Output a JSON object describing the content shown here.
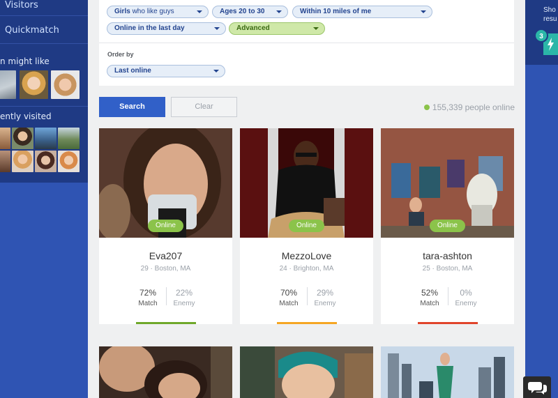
{
  "sidebar": {
    "visitors_label": "Visitors",
    "quickmatch_label": "Quickmatch",
    "might_like_heading": "n might like",
    "recently_visited_heading": "ently visited"
  },
  "filters": {
    "gender": {
      "bold": "Girls",
      "light": " who like guys"
    },
    "age": "Ages 20 to 30",
    "distance": "Within 10 miles of me",
    "activity": "Online in the last day",
    "advanced": "Advanced",
    "order_by_label": "Order by",
    "order_by_value": "Last online"
  },
  "actions": {
    "search_label": "Search",
    "clear_label": "Clear"
  },
  "online": {
    "text": "155,339 people online"
  },
  "colors": {
    "accent": "#3160c8",
    "online_green": "#8bc34a",
    "sidebar_dark": "#1f3a84",
    "sidebar_blue": "#2f54b3",
    "bar_green": "#6fa82a",
    "bar_orange": "#f5a623",
    "bar_red": "#e0442b"
  },
  "profiles": [
    {
      "name": "Eva207",
      "meta": "29 · Boston, MA",
      "badge": "Online",
      "match_pct": "72%",
      "match_label": "Match",
      "enemy_pct": "22%",
      "enemy_label": "Enemy"
    },
    {
      "name": "MezzoLove",
      "meta": "24 · Brighton, MA",
      "badge": "Online",
      "match_pct": "70%",
      "match_label": "Match",
      "enemy_pct": "29%",
      "enemy_label": "Enemy"
    },
    {
      "name": "tara-ashton",
      "meta": "25 · Boston, MA",
      "badge": "Online",
      "match_pct": "52%",
      "match_label": "Match",
      "enemy_pct": "0%",
      "enemy_label": "Enemy"
    }
  ],
  "rightbar": {
    "line1": "Sho",
    "line2": "resu",
    "boost_count": "3"
  },
  "chat": {
    "icon": "chat-bubbles-icon"
  }
}
